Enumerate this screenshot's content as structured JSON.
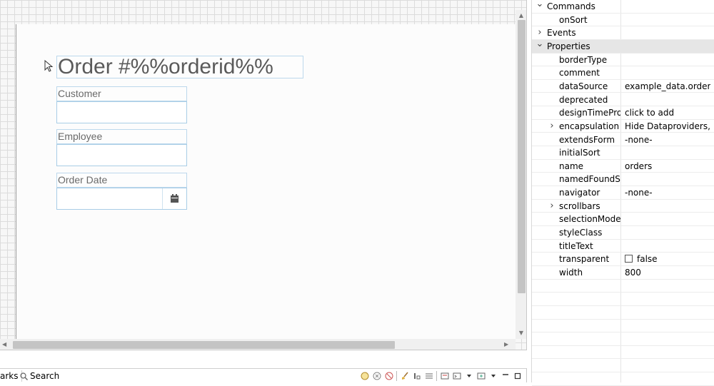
{
  "designer": {
    "title_text": "Order #%%orderid%%",
    "customer_label": "Customer",
    "employee_label": "Employee",
    "orderdate_label": "Order Date"
  },
  "bottom_bar": {
    "bookmarks_tab": "arks",
    "search_tab": "Search"
  },
  "properties": {
    "rows": [
      {
        "name": "Commands",
        "value": "",
        "kind": "section-open"
      },
      {
        "name": "onSort",
        "value": "",
        "kind": "child"
      },
      {
        "name": "Events",
        "value": "",
        "kind": "section-closed"
      },
      {
        "name": "Properties",
        "value": "",
        "kind": "section-open"
      },
      {
        "name": "borderType",
        "value": "",
        "kind": "child"
      },
      {
        "name": "comment",
        "value": "",
        "kind": "child"
      },
      {
        "name": "dataSource",
        "value": "example_data.orders",
        "kind": "child"
      },
      {
        "name": "deprecated",
        "value": "",
        "kind": "child"
      },
      {
        "name": "designTimeProp",
        "value": "click to add",
        "kind": "child"
      },
      {
        "name": "encapsulation",
        "value": "Hide Dataproviders,...",
        "kind": "child-collapsed"
      },
      {
        "name": "extendsForm",
        "value": "-none-",
        "kind": "child"
      },
      {
        "name": "initialSort",
        "value": "",
        "kind": "child"
      },
      {
        "name": "name",
        "value": "orders",
        "kind": "child"
      },
      {
        "name": "namedFoundSet",
        "value": "",
        "kind": "child"
      },
      {
        "name": "navigator",
        "value": "-none-",
        "kind": "child"
      },
      {
        "name": "scrollbars",
        "value": "",
        "kind": "child-collapsed"
      },
      {
        "name": "selectionMode",
        "value": "",
        "kind": "child"
      },
      {
        "name": "styleClass",
        "value": "",
        "kind": "child"
      },
      {
        "name": "titleText",
        "value": "",
        "kind": "child"
      },
      {
        "name": "transparent",
        "value": "false",
        "kind": "child-checkbox"
      },
      {
        "name": "width",
        "value": "800",
        "kind": "child"
      }
    ]
  }
}
